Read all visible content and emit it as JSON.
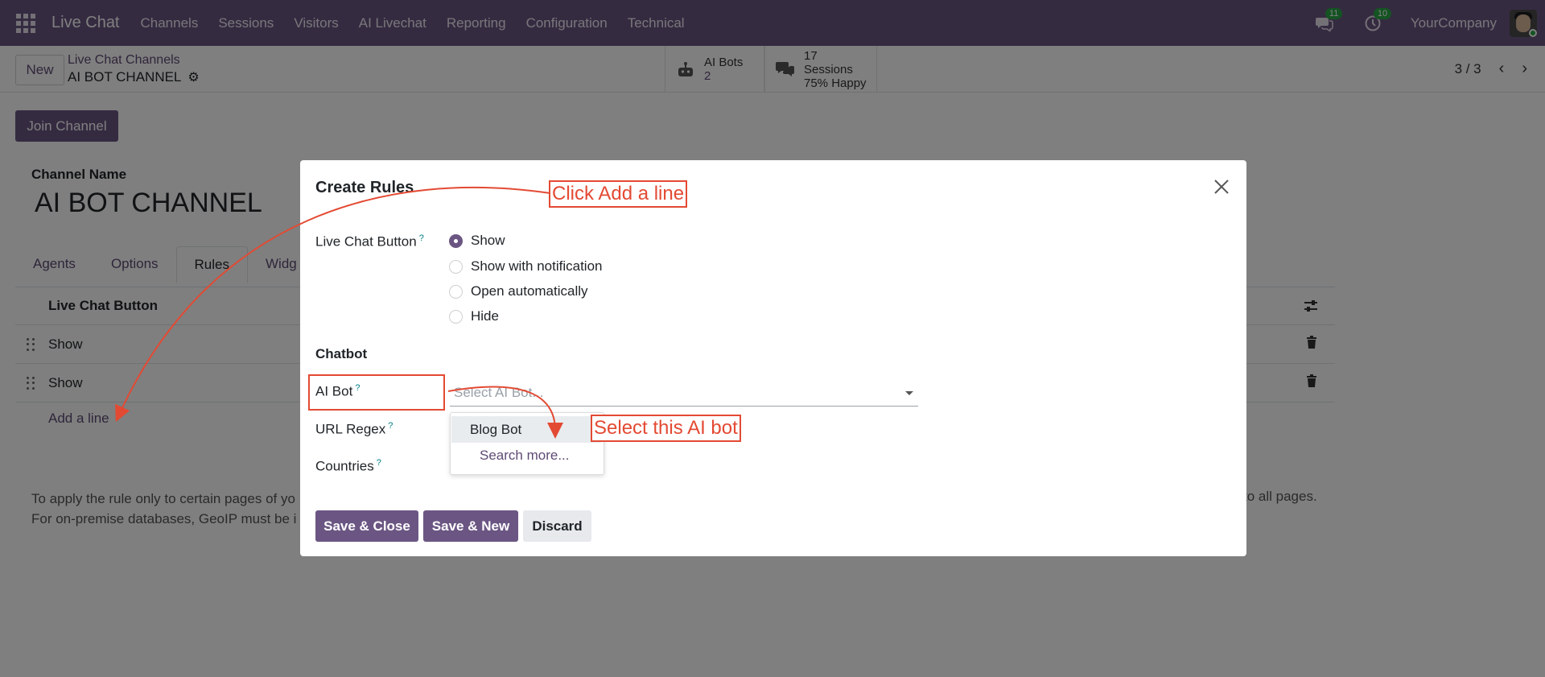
{
  "topnav": {
    "app_title": "Live Chat",
    "menu": [
      "Channels",
      "Sessions",
      "Visitors",
      "AI Livechat",
      "Reporting",
      "Configuration",
      "Technical"
    ],
    "messages_badge": "11",
    "activities_badge": "10",
    "company": "YourCompany"
  },
  "control_panel": {
    "new_button": "New",
    "breadcrumb_parent": "Live Chat Channels",
    "breadcrumb_current": "AI BOT CHANNEL",
    "ai_bots_label": "AI Bots",
    "ai_bots_count": "2",
    "sessions_label": "17 Sessions",
    "sessions_happy": "75% Happy",
    "pager": "3 / 3"
  },
  "form": {
    "join_button": "Join Channel",
    "channel_name_label": "Channel Name",
    "channel_name_value": "AI BOT CHANNEL",
    "tabs": [
      "Agents",
      "Options",
      "Rules",
      "Widg"
    ],
    "active_tab": "Rules",
    "list_header": "Live Chat Button",
    "rows": [
      "Show",
      "Show"
    ],
    "add_line": "Add a line",
    "help_line1": "To apply the rule only to certain pages of yo",
    "help_line2": "For on-premise databases, GeoIP must be i",
    "help_right": "to all pages."
  },
  "modal": {
    "title": "Create Rules",
    "live_chat_button_label": "Live Chat Button",
    "radio_options": [
      "Show",
      "Show with notification",
      "Open automatically",
      "Hide"
    ],
    "selected_option": "Show",
    "chatbot_label": "Chatbot",
    "ai_bot_label": "AI Bot",
    "ai_bot_placeholder": "Select AI Bot...",
    "url_regex_label": "URL Regex",
    "countries_label": "Countries",
    "help_marker": "?",
    "dropdown_items": [
      "Blog Bot"
    ],
    "dropdown_more": "Search more...",
    "save_close": "Save & Close",
    "save_new": "Save & New",
    "discard": "Discard"
  },
  "annotations": {
    "click_add_line": "Click Add a line",
    "select_bot": "Select this AI bot",
    "color": "#e34a33"
  },
  "colors": {
    "brand": "#6b5683",
    "link": "#5f4b74"
  }
}
